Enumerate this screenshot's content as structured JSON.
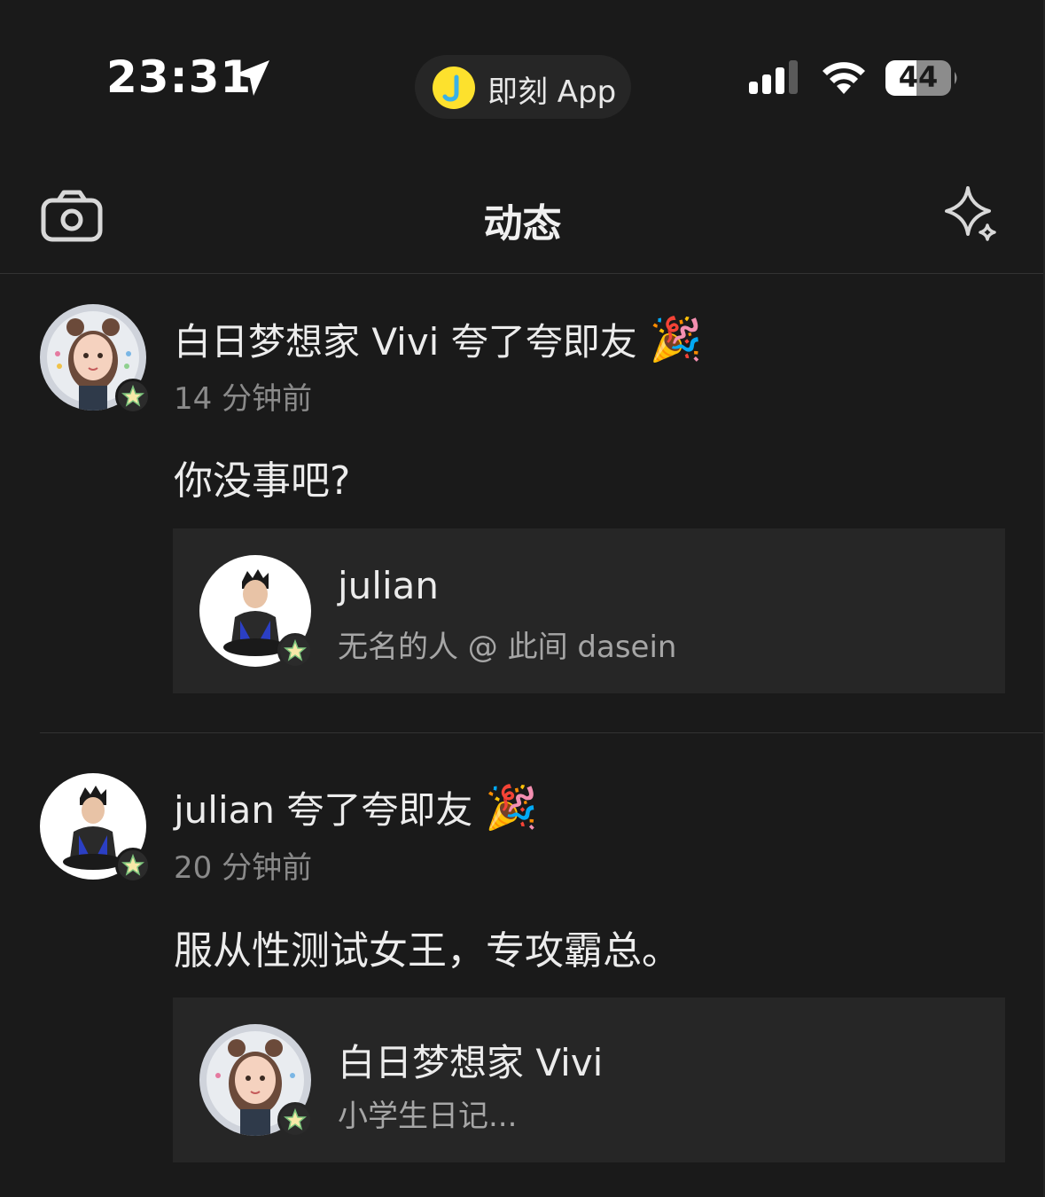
{
  "status_bar": {
    "time": "23:31",
    "island_app": "即刻 App",
    "battery": "44",
    "icons": [
      "location-arrow-icon",
      "cellular-signal-icon",
      "wifi-icon",
      "battery-icon"
    ]
  },
  "nav": {
    "title": "动态",
    "left_icon": "camera-icon",
    "right_icon": "sparkle-icon"
  },
  "feed": [
    {
      "headline": "白日梦想家 Vivi 夸了夸即友",
      "emoji": "🎉",
      "time": "14 分钟前",
      "message": "你没事吧?",
      "card": {
        "name": "julian",
        "bio": "无名的人 @ 此间 dasein"
      }
    },
    {
      "headline": "julian 夸了夸即友",
      "emoji": "🎉",
      "time": "20 分钟前",
      "message": "服从性测试女王，专攻霸总。",
      "card": {
        "name": "白日梦想家 Vivi",
        "bio": "小学生日记..."
      }
    }
  ],
  "colors": {
    "background": "#1a1a1a",
    "card": "#262626",
    "text": "#ececec",
    "muted": "#8a8a8a",
    "jike_yellow": "#fde12d"
  }
}
